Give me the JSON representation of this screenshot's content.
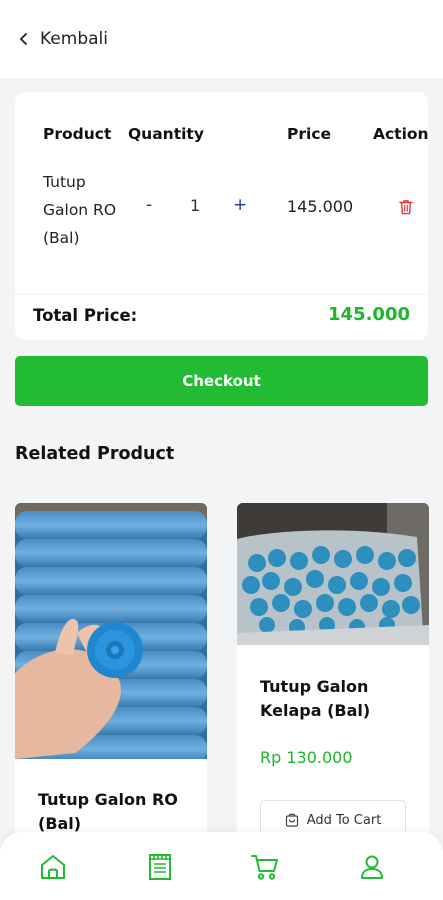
{
  "header": {
    "back_label": "Kembali"
  },
  "cart": {
    "headers": {
      "product": "Product",
      "quantity": "Quantity",
      "price": "Price",
      "action": "Action"
    },
    "items": [
      {
        "name": "Tutup Galon RO (Bal)",
        "qty_minus": "-",
        "quantity": "1",
        "qty_plus": "+",
        "price": "145.000"
      }
    ],
    "total_label": "Total Price:",
    "total_value": "145.000"
  },
  "checkout_label": "Checkout",
  "related": {
    "title": "Related Product",
    "products": [
      {
        "name": "Tutup Galon RO (Bal)",
        "price": "",
        "button": ""
      },
      {
        "name": "Tutup Galon Kelapa (Bal)",
        "price": "Rp 130.000",
        "button": "Add To Cart"
      }
    ]
  },
  "colors": {
    "accent": "#22bb33",
    "price_green": "#1db52a",
    "delete_red": "#e53935"
  },
  "icons": {
    "back": "chevron-left-icon",
    "delete": "trash-icon",
    "cart_add": "cart-add-icon",
    "nav": [
      "home-icon",
      "orders-icon",
      "cart-icon",
      "user-icon"
    ]
  }
}
